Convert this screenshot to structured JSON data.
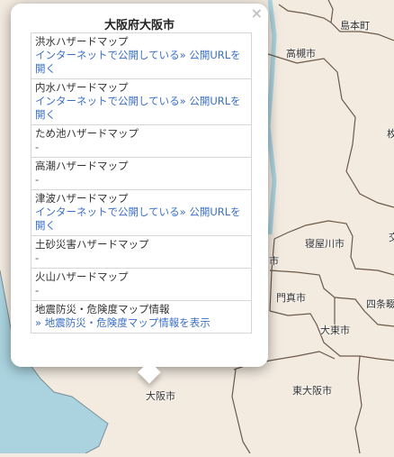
{
  "map": {
    "colors": {
      "land": "#f3ebe0",
      "water": "#aad3df",
      "border": "#6b5a4a"
    },
    "labels": {
      "shimamotocho": "島本町",
      "takatsuki": "高槻市",
      "neyagawa": "寝屋川市",
      "moriguchi_partial": "市",
      "kadoma": "門真市",
      "shijonawate": "四条畷",
      "daito": "大東市",
      "osaka": "大阪市",
      "higashiosaka": "東大阪市",
      "edge_right_1": "枚",
      "edge_right_2": "交"
    }
  },
  "popup": {
    "title": "大阪府大阪市",
    "close_label": "×",
    "items": [
      {
        "title": "洪水ハザードマップ",
        "value": "インターネットで公開している» 公開URLを開く",
        "type": "link"
      },
      {
        "title": "内水ハザードマップ",
        "value": "インターネットで公開している» 公開URLを開く",
        "type": "link"
      },
      {
        "title": "ため池ハザードマップ",
        "value": "-",
        "type": "text"
      },
      {
        "title": "高潮ハザードマップ",
        "value": "-",
        "type": "text"
      },
      {
        "title": "津波ハザードマップ",
        "value": "インターネットで公開している» 公開URLを開く",
        "type": "link"
      },
      {
        "title": "土砂災害ハザードマップ",
        "value": "-",
        "type": "text"
      },
      {
        "title": "火山ハザードマップ",
        "value": "-",
        "type": "text"
      },
      {
        "title": "地震防災・危険度マップ情報",
        "value": "» 地震防災・危険度マップ情報を表示",
        "type": "link"
      }
    ]
  }
}
